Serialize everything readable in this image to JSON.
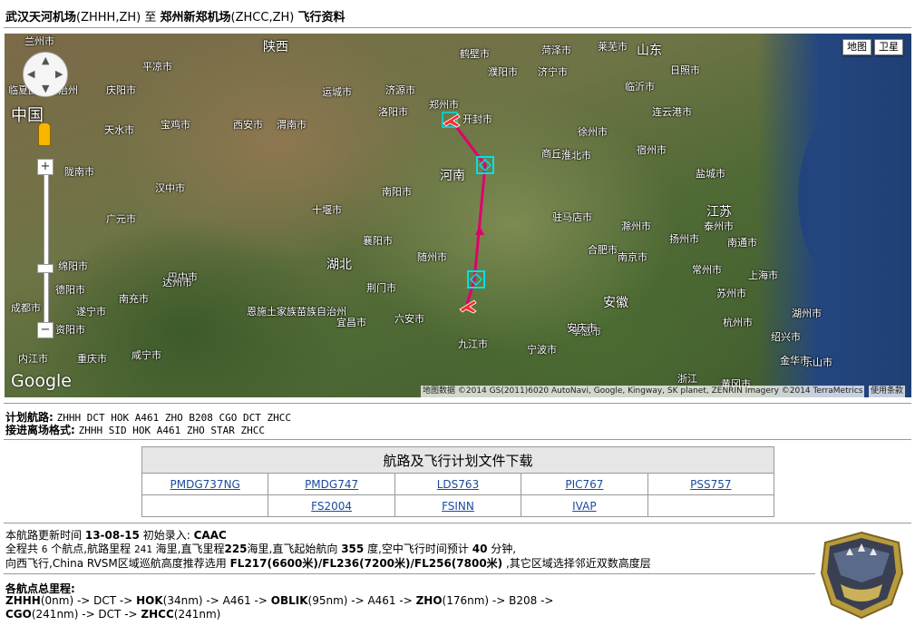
{
  "title": {
    "from": "武汉天河机场",
    "from_code": "(ZHHH,ZH)",
    "to_word": "至",
    "to": "郑州新郑机场",
    "to_code": "(ZHCC,ZH)",
    "suffix": "飞行资料"
  },
  "map": {
    "type_buttons": [
      "地图",
      "卫星"
    ],
    "google_logo": "Google",
    "attribution": "地图数据 ©2014 GS(2011)6020 AutoNavi, Google, Kingway, SK planet, ZENRIN Imagery ©2014 TerraMetrics",
    "terms": "使用条款",
    "zoom_in": "+",
    "zoom_out": "−",
    "route_color": "#e0006a",
    "waypoint_color": "#00e0e8",
    "places": [
      "兰州市",
      "临夏回族自治州",
      "中国",
      "天水市",
      "宝鸡市",
      "西安市",
      "渭南市",
      "平凉市",
      "庆阳市",
      "陕西",
      "运城市",
      "济源市",
      "洛阳市",
      "郑州市",
      "开封市",
      "鹤壁市",
      "濮阳市",
      "菏泽市",
      "济宁市",
      "莱芜市",
      "山东",
      "日照市",
      "临沂市",
      "连云港市",
      "徐州市",
      "商丘市",
      "宿州市",
      "淮北市",
      "盐城市",
      "河南",
      "陇南市",
      "汉中市",
      "广元市",
      "十堰市",
      "南阳市",
      "驻马店市",
      "江苏",
      "泰州市",
      "南通市",
      "扬州市",
      "滁州市",
      "南京市",
      "合肥市",
      "常州市",
      "上海市",
      "苏州市",
      "襄阳市",
      "随州市",
      "湖北",
      "绵阳市",
      "德阳市",
      "巴中市",
      "达州市",
      "南充市",
      "遂宁市",
      "成都市",
      "资阳市",
      "荆门市",
      "恩施土家族苗族自治州",
      "宜昌市",
      "孝感市",
      "安徽",
      "安庆市",
      "杭州市",
      "湖州市",
      "绍兴市",
      "乐山市",
      "内江市",
      "重庆市",
      "咸宁市",
      "九江市",
      "宁波市",
      "金华市",
      "浙江",
      "黄冈市",
      "六安市"
    ]
  },
  "plan": {
    "route_label": "计划航路",
    "route_value": "ZHHH DCT HOK A461 ZHO B208 CGO DCT ZHCC",
    "format_label": "接进离场格式",
    "format_value": "ZHHH SID HOK A461 ZHO STAR ZHCC"
  },
  "downloads": {
    "header": "航路及飞行计划文件下载",
    "row1": [
      "PMDG737NG",
      "PMDG747",
      "LDS763",
      "PIC767",
      "PSS757"
    ],
    "row2": [
      "",
      "FS2004",
      "FSINN",
      "IVAP",
      ""
    ]
  },
  "info": {
    "update_prefix": "本航路更新时间",
    "update_date": "13-08-15",
    "entry_prefix": "初始录入:",
    "entry_by": "CAAC",
    "line2_a": "全程共",
    "waypoints": "6",
    "line2_b": "个航点,航路里程",
    "route_nm": "241",
    "line2_c": "海里,直飞里程",
    "direct_nm": "225",
    "line2_d": "海里,直飞起始航向",
    "heading": "355",
    "line2_e": "度,空中飞行时间预计",
    "minutes": "40",
    "line2_f": "分钟,",
    "line3_a": "向西飞行,China RVSM区域巡航高度推荐选用",
    "levels": "FL217(6600米)/FL236(7200米)/FL256(7800米)",
    "line3_b": ",其它区域选择邻近双数高度层"
  },
  "legs": {
    "label": "各航点总里程:",
    "line1": [
      {
        "b": "ZHHH",
        "t": "(0nm) -> DCT -> "
      },
      {
        "b": "HOK",
        "t": "(34nm) -> A461 -> "
      },
      {
        "b": "OBLIK",
        "t": "(95nm) -> A461 -> "
      },
      {
        "b": "ZHO",
        "t": "(176nm) -> B208 ->"
      }
    ],
    "line2": [
      {
        "b": "CGO",
        "t": "(241nm) -> DCT -> "
      },
      {
        "b": "ZHCC",
        "t": "(241nm)"
      }
    ]
  }
}
